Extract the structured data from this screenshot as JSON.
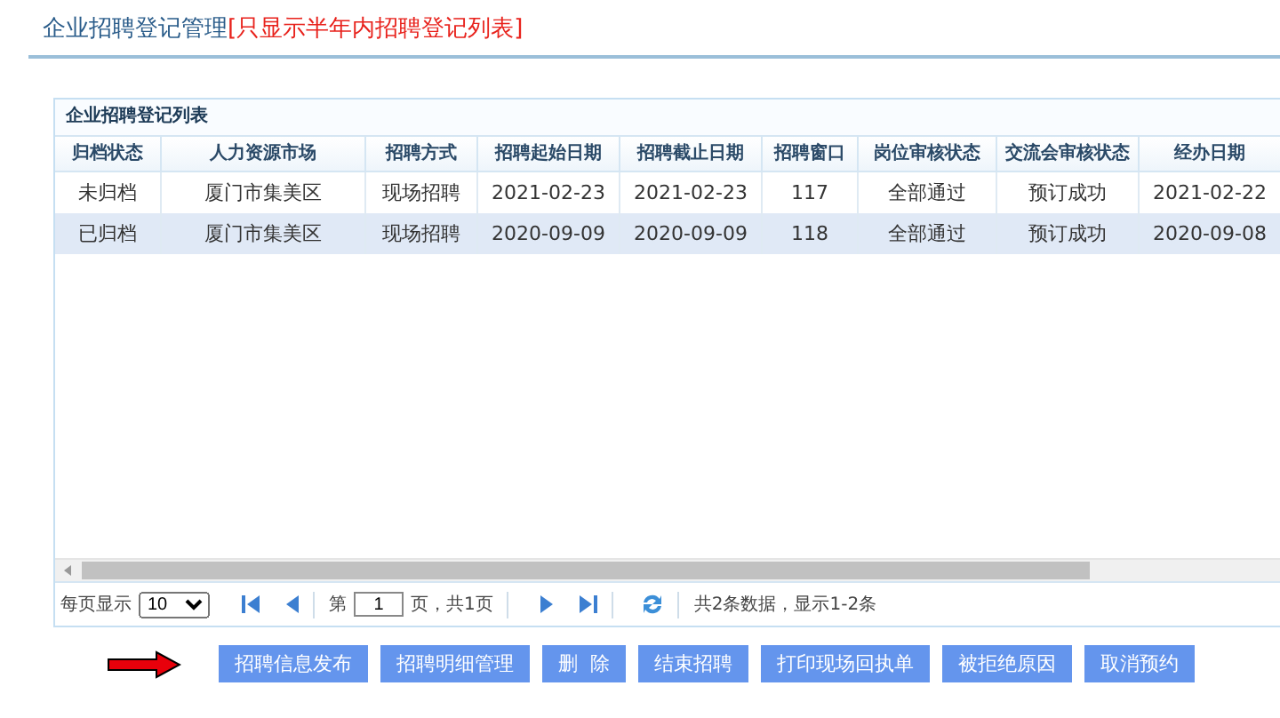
{
  "page": {
    "title": "企业招聘登记管理",
    "title_note": "[只显示半年内招聘登记列表]"
  },
  "panel": {
    "title": "企业招聘登记列表"
  },
  "table": {
    "columns": [
      "归档状态",
      "人力资源市场",
      "招聘方式",
      "招聘起始日期",
      "招聘截止日期",
      "招聘窗口",
      "岗位审核状态",
      "交流会审核状态",
      "经办日期"
    ],
    "rows": [
      {
        "selected": false,
        "cells": [
          "未归档",
          "厦门市集美区",
          "现场招聘",
          "2021-02-23",
          "2021-02-23",
          "117",
          "全部通过",
          "预订成功",
          "2021-02-22"
        ]
      },
      {
        "selected": true,
        "cells": [
          "已归档",
          "厦门市集美区",
          "现场招聘",
          "2020-09-09",
          "2020-09-09",
          "118",
          "全部通过",
          "预订成功",
          "2020-09-08"
        ]
      }
    ]
  },
  "pager": {
    "page_size_label": "每页显示",
    "page_size": "10",
    "page_prefix": "第",
    "page": "1",
    "page_suffix": "页，共1页",
    "summary": "共2条数据，显示1-2条"
  },
  "buttons": [
    "招聘信息发布",
    "招聘明细管理",
    "删  除",
    "结束招聘",
    "打印现场回执单",
    "被拒绝原因",
    "取消预约"
  ]
}
